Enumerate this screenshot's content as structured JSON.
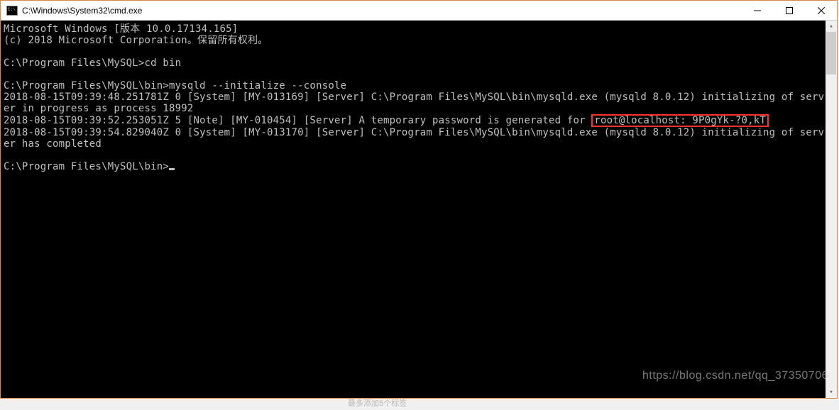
{
  "window": {
    "title": "C:\\Windows\\System32\\cmd.exe"
  },
  "terminal": {
    "header1": "Microsoft Windows [版本 10.0.17134.165]",
    "header2": "(c) 2018 Microsoft Corporation。保留所有权利。",
    "prompt1": "C:\\Program Files\\MySQL>cd bin",
    "prompt2": "C:\\Program Files\\MySQL\\bin>mysqld --initialize --console",
    "line1": "2018-08-15T09:39:48.251781Z 0 [System] [MY-013169] [Server] C:\\Program Files\\MySQL\\bin\\mysqld.exe (mysqld 8.0.12) initializing of server in progress as process 18992",
    "line2_pre": "2018-08-15T09:39:52.253051Z 5 [Note] [MY-010454] [Server] A temporary password is generated for ",
    "line2_highlight": "root@localhost: 9P0gYk-?0,kT",
    "line3": "2018-08-15T09:39:54.829040Z 0 [System] [MY-013170] [Server] C:\\Program Files\\MySQL\\bin\\mysqld.exe (mysqld 8.0.12) initializing of server has completed",
    "prompt3": "C:\\Program Files\\MySQL\\bin>"
  },
  "watermark": "https://blog.csdn.net/qq_37350706",
  "footer_hint": "最多添加5个标签"
}
